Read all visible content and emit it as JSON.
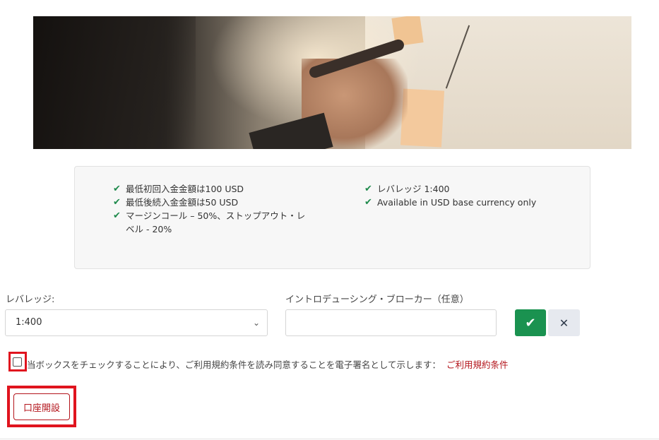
{
  "features": {
    "left": [
      "最低初回入金金額は100 USD",
      "最低後続入金金額は50 USD",
      "マージンコール – 50%、ストップアウト・レベル - 20%"
    ],
    "right": [
      "レバレッジ 1:400",
      "Available in USD base currency only"
    ]
  },
  "form": {
    "leverage_label": "レバレッジ:",
    "leverage_value": "1:400",
    "intro_label": "イントロデューシング・ブローカー（任意）",
    "intro_placeholder": ""
  },
  "agreement": {
    "text": "当ボックスをチェックすることにより、ご利用規約条件を読み同意することを電子署名として示します：",
    "link": "ご利用規約条件"
  },
  "open_account_label": "口座開設",
  "colors": {
    "accent": "#b3141b",
    "confirm": "#1a9250",
    "highlight": "#e0141e",
    "check": "#1f8a4c"
  },
  "icons": {
    "confirm": "check-icon",
    "cancel": "close-icon",
    "feature": "check-icon",
    "select": "chevron-down-icon"
  }
}
